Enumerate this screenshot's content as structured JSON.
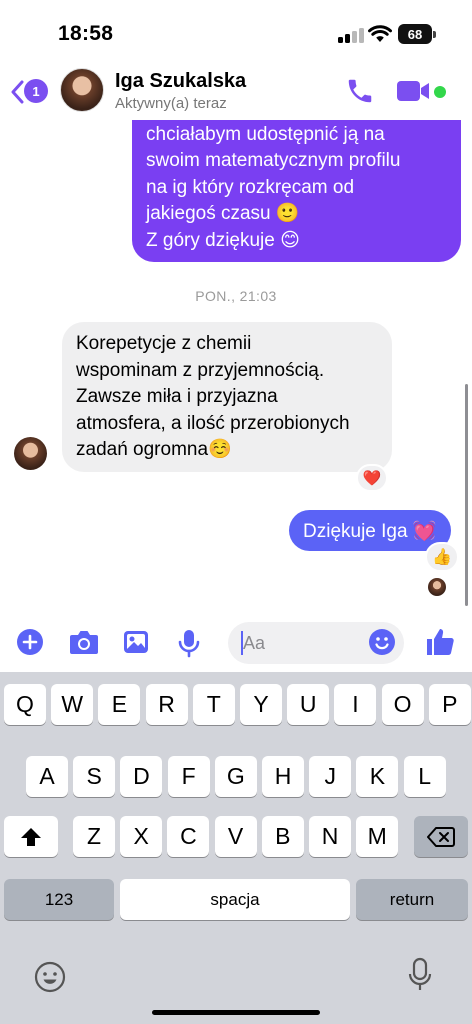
{
  "status_bar": {
    "time": "18:58",
    "battery": "68"
  },
  "header": {
    "unread_count": "1",
    "contact_name": "Iga Szukalska",
    "contact_status": "Aktywny(a) teraz",
    "accent_color": "#7b4ff0",
    "online_color": "#32d74b"
  },
  "messages": {
    "outgoing_top": "chciałabym udostępnić ją na\nswoim matematycznym profilu\nna ig który rozkręcam od\njakiegoś czasu 🙂\nZ góry dziękuje 😊",
    "timestamp": "PON., 21:03",
    "incoming": "Korepetycje z chemii\nwspominam z przyjemnością.\nZawsze miła i przyjazna\natmosfera, a ilość przerobionych\nzadań ogromna☺️",
    "incoming_reaction": "❤️",
    "outgoing_last": "Dziękuje Iga 💓",
    "outgoing_reaction": "👍",
    "outgoing_color": "#7a3ff2",
    "outgoing_last_color": "#5b63f6"
  },
  "composer": {
    "placeholder": "Aa",
    "icons": [
      "plus-icon",
      "camera-icon",
      "image-icon",
      "microphone-icon",
      "emoji-icon",
      "like-icon"
    ]
  },
  "keyboard": {
    "row1": [
      "Q",
      "W",
      "E",
      "R",
      "T",
      "Y",
      "U",
      "I",
      "O",
      "P"
    ],
    "row2": [
      "A",
      "S",
      "D",
      "F",
      "G",
      "H",
      "J",
      "K",
      "L"
    ],
    "row3": [
      "Z",
      "X",
      "C",
      "V",
      "B",
      "N",
      "M"
    ],
    "numbers_label": "123",
    "space_label": "spacja",
    "return_label": "return"
  }
}
